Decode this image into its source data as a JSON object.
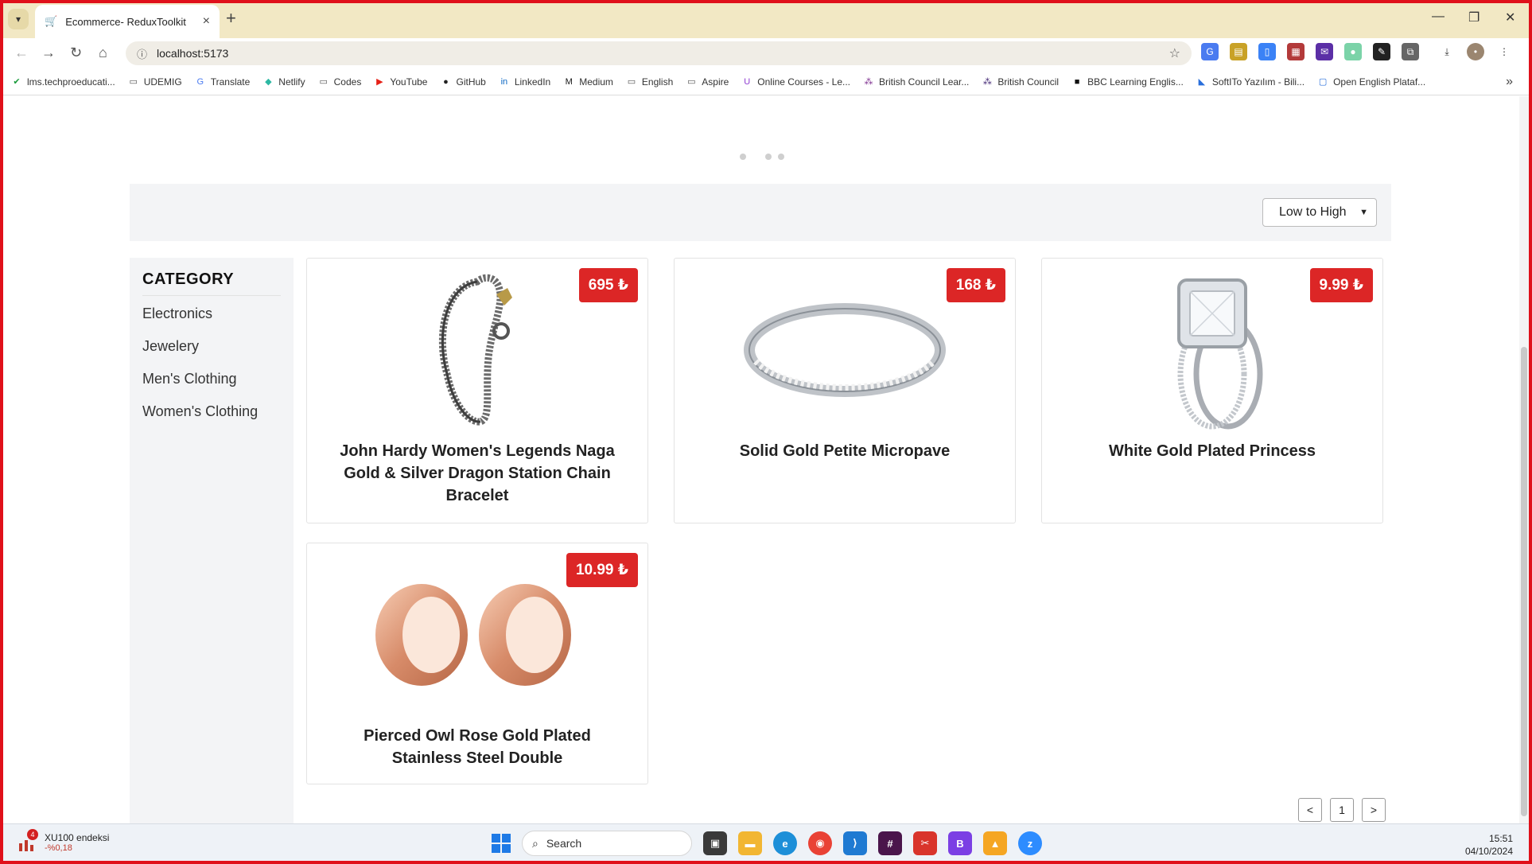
{
  "browser": {
    "tab_title": "Ecommerce- ReduxToolkit",
    "url": "localhost:5173",
    "bookmarks": [
      {
        "label": "lms.techproeducati...",
        "icon": "check-circle-icon",
        "color": "#1a9b3c"
      },
      {
        "label": "UDEMIG",
        "icon": "folder-icon",
        "color": "#555555"
      },
      {
        "label": "Translate",
        "icon": "translate-icon",
        "color": "#4a7bf0"
      },
      {
        "label": "Netlify",
        "icon": "netlify-icon",
        "color": "#2db8a3"
      },
      {
        "label": "Codes",
        "icon": "folder-icon",
        "color": "#555555"
      },
      {
        "label": "YouTube",
        "icon": "youtube-icon",
        "color": "#e62117"
      },
      {
        "label": "GitHub",
        "icon": "github-icon",
        "color": "#222222"
      },
      {
        "label": "LinkedIn",
        "icon": "linkedin-icon",
        "color": "#0a66c2"
      },
      {
        "label": "Medium",
        "icon": "medium-icon",
        "color": "#111111"
      },
      {
        "label": "English",
        "icon": "folder-icon",
        "color": "#555555"
      },
      {
        "label": "Aspire",
        "icon": "folder-icon",
        "color": "#555555"
      },
      {
        "label": "Online Courses - Le...",
        "icon": "udemy-icon",
        "color": "#8e3cd1"
      },
      {
        "label": "British Council Lear...",
        "icon": "british-council-icon",
        "color": "#7a2a8c"
      },
      {
        "label": "British Council",
        "icon": "british-council-icon",
        "color": "#3a1d6e"
      },
      {
        "label": "BBC Learning Englis...",
        "icon": "bbc-icon",
        "color": "#111111"
      },
      {
        "label": "SoftITo Yazılım - Bili...",
        "icon": "softito-icon",
        "color": "#2a6fdb"
      },
      {
        "label": "Open English Plataf...",
        "icon": "page-icon",
        "color": "#2a6fdb"
      }
    ]
  },
  "sort": {
    "selected": "Low to High"
  },
  "sidebar": {
    "heading": "CATEGORY",
    "items": [
      "Electronics",
      "Jewelery",
      "Men's Clothing",
      "Women's Clothing"
    ]
  },
  "products": [
    {
      "title": "John Hardy Women's Legends Naga Gold & Silver Dragon Station Chain Bracelet",
      "price": "695 ₺",
      "image": "bracelet-image"
    },
    {
      "title": "Solid Gold Petite Micropave",
      "price": "168 ₺",
      "image": "ring-image"
    },
    {
      "title": "White Gold Plated Princess",
      "price": "9.99 ₺",
      "image": "princess-ring-image"
    },
    {
      "title": "Pierced Owl Rose Gold Plated Stainless Steel Double",
      "price": "10.99 ₺",
      "image": "ear-tunnels-image"
    }
  ],
  "pagination": {
    "prev": "<",
    "current": "1",
    "next": ">"
  },
  "taskbar": {
    "stock_name": "XU100 endeksi",
    "stock_change": "-%0,18",
    "stock_badge": "4",
    "search_placeholder": "Search",
    "time": "15:51",
    "date": "04/10/2024"
  },
  "colors": {
    "price_badge": "#dc2626",
    "panel_bg": "#f3f4f6",
    "accent": "#1e7ae6"
  }
}
